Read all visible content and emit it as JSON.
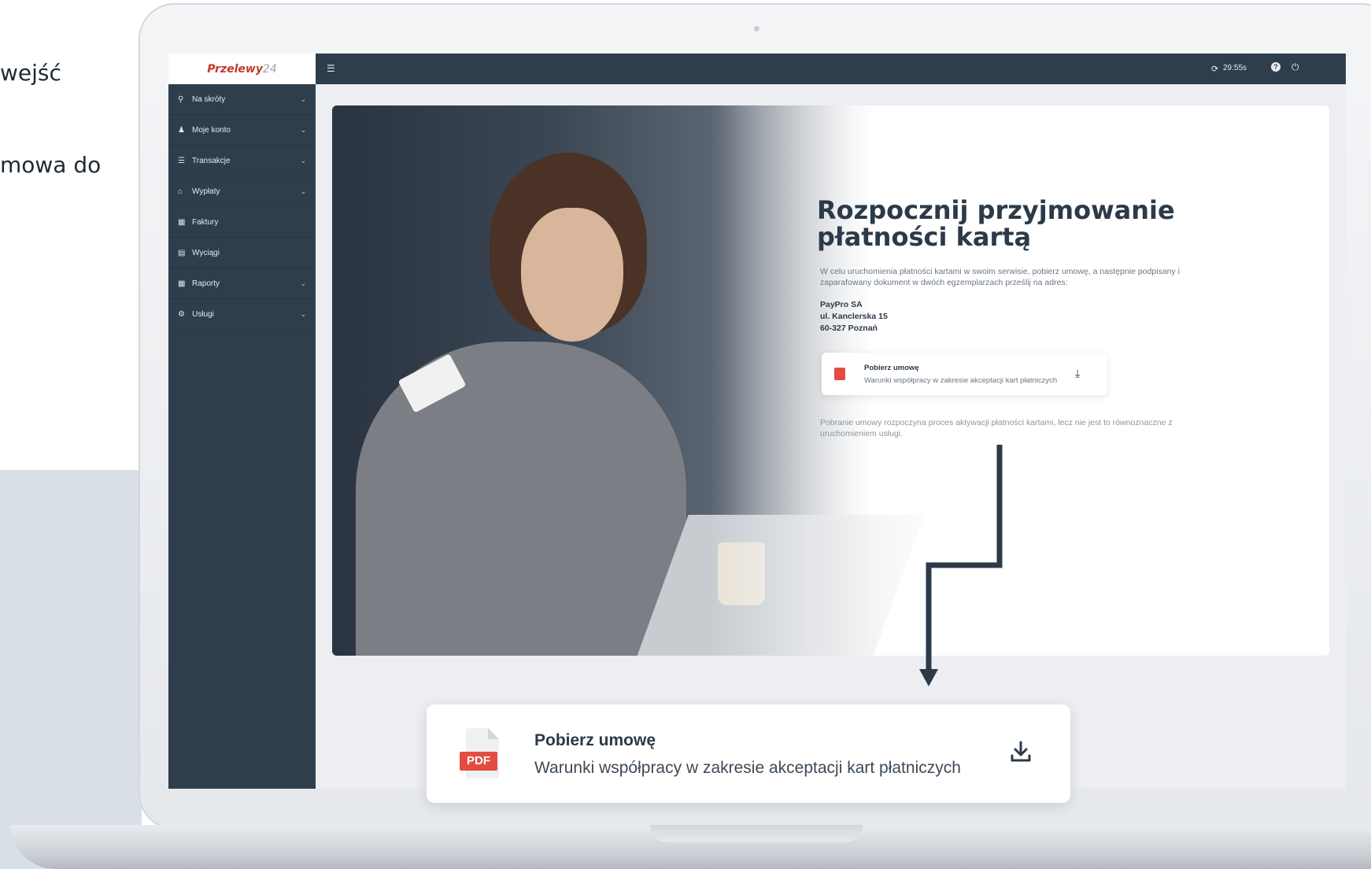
{
  "background_copy": {
    "line1": "wejść",
    "line2": "mowa do"
  },
  "app": {
    "logo": {
      "brand": "Przelewy",
      "number": "24"
    }
  },
  "sidebar": {
    "items": [
      {
        "label": "Na skróty",
        "icon": "map-marker-icon",
        "has_submenu": true
      },
      {
        "label": "Moje konto",
        "icon": "user-icon",
        "has_submenu": true
      },
      {
        "label": "Transakcje",
        "icon": "list-icon",
        "has_submenu": true
      },
      {
        "label": "Wypłaty",
        "icon": "bank-icon",
        "has_submenu": true
      },
      {
        "label": "Faktury",
        "icon": "calculator-icon",
        "has_submenu": false
      },
      {
        "label": "Wyciągi",
        "icon": "file-icon",
        "has_submenu": false
      },
      {
        "label": "Raporty",
        "icon": "table-icon",
        "has_submenu": true
      },
      {
        "label": "Usługi",
        "icon": "cogs-icon",
        "has_submenu": true
      }
    ]
  },
  "topbar": {
    "session_timer": "29:55s"
  },
  "content": {
    "headline": "Rozpocznij przyjmowanie płatności kartą",
    "intro": "W celu uruchomienia płatności kartami w swoim serwisie, pobierz umowę, a następnie podpisany i zaparafowany dokument w dwóch egzemplarzach prześlij na adres:",
    "address": {
      "company": "PayPro SA",
      "street": "ul. Kanclerska 15",
      "city": "60-327 Poznań"
    },
    "download": {
      "title": "Pobierz umowę",
      "subtitle": "Warunki współpracy w zakresie akceptacji kart płatniczych"
    },
    "footnote": "Pobranie umowy rozpoczyna proces aktywacji płatności kartami, lecz nie jest to równoznaczne z uruchomieniem usługi."
  },
  "callout": {
    "file_type": "PDF",
    "title": "Pobierz umowę",
    "subtitle": "Warunki współpracy w zakresie akceptacji kart płatniczych"
  },
  "colors": {
    "sidebar": "#2e3e4d",
    "accent_pdf": "#e44c43",
    "text_dark": "#2c3a48"
  }
}
